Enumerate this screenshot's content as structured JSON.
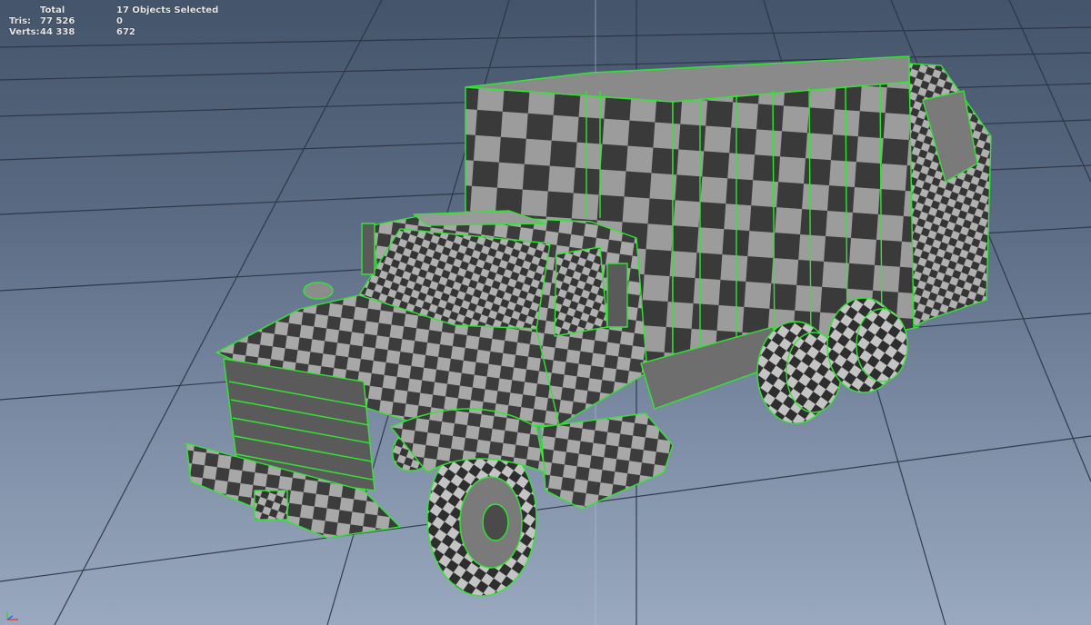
{
  "hud": {
    "header": {
      "total_label": "Total",
      "selection_label": "17 Objects Selected"
    },
    "rows": [
      {
        "label": "Tris:",
        "total": "77 526",
        "selected": "0"
      },
      {
        "label": "Verts:",
        "total": "44 338",
        "selected": "672"
      }
    ]
  },
  "viewport": {
    "background_top": "#44546a",
    "background_bottom": "#9aa9bf",
    "grid_color": "#2b3344",
    "selection_wire_color": "#32e632",
    "checker_dark": "#3c3c3c",
    "checker_light": "#a8a8a8",
    "model": "garbage-truck"
  }
}
